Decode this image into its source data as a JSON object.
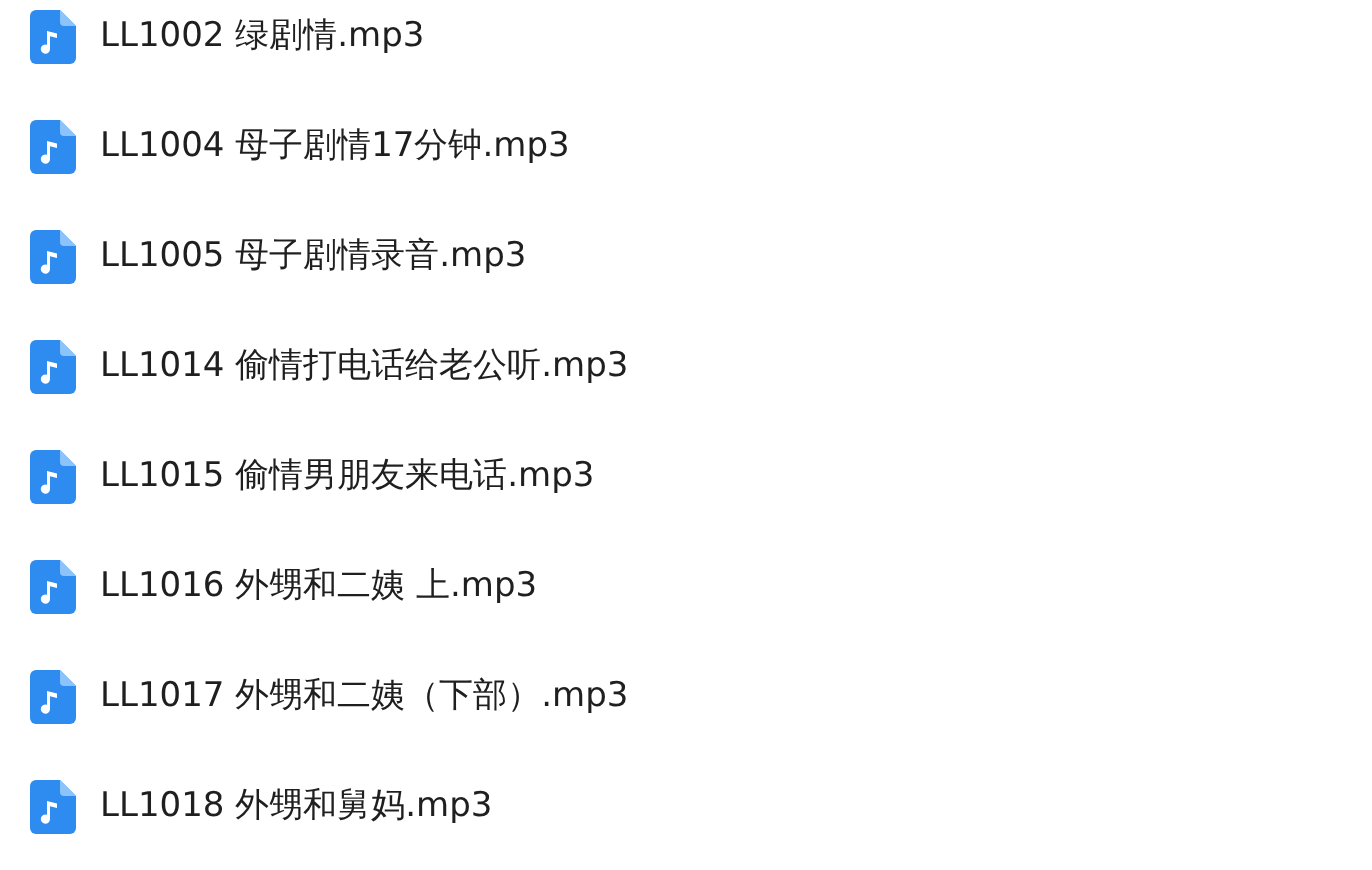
{
  "files": [
    {
      "name": "LL1002 绿剧情.mp3"
    },
    {
      "name": "LL1004 母子剧情17分钟.mp3"
    },
    {
      "name": "LL1005 母子剧情录音.mp3"
    },
    {
      "name": "LL1014 偷情打电话给老公听.mp3"
    },
    {
      "name": "LL1015 偷情男朋友来电话.mp3"
    },
    {
      "name": "LL1016 外甥和二姨 上.mp3"
    },
    {
      "name": "LL1017 外甥和二姨（下部）.mp3"
    },
    {
      "name": "LL1018 外甥和舅妈.mp3"
    }
  ]
}
